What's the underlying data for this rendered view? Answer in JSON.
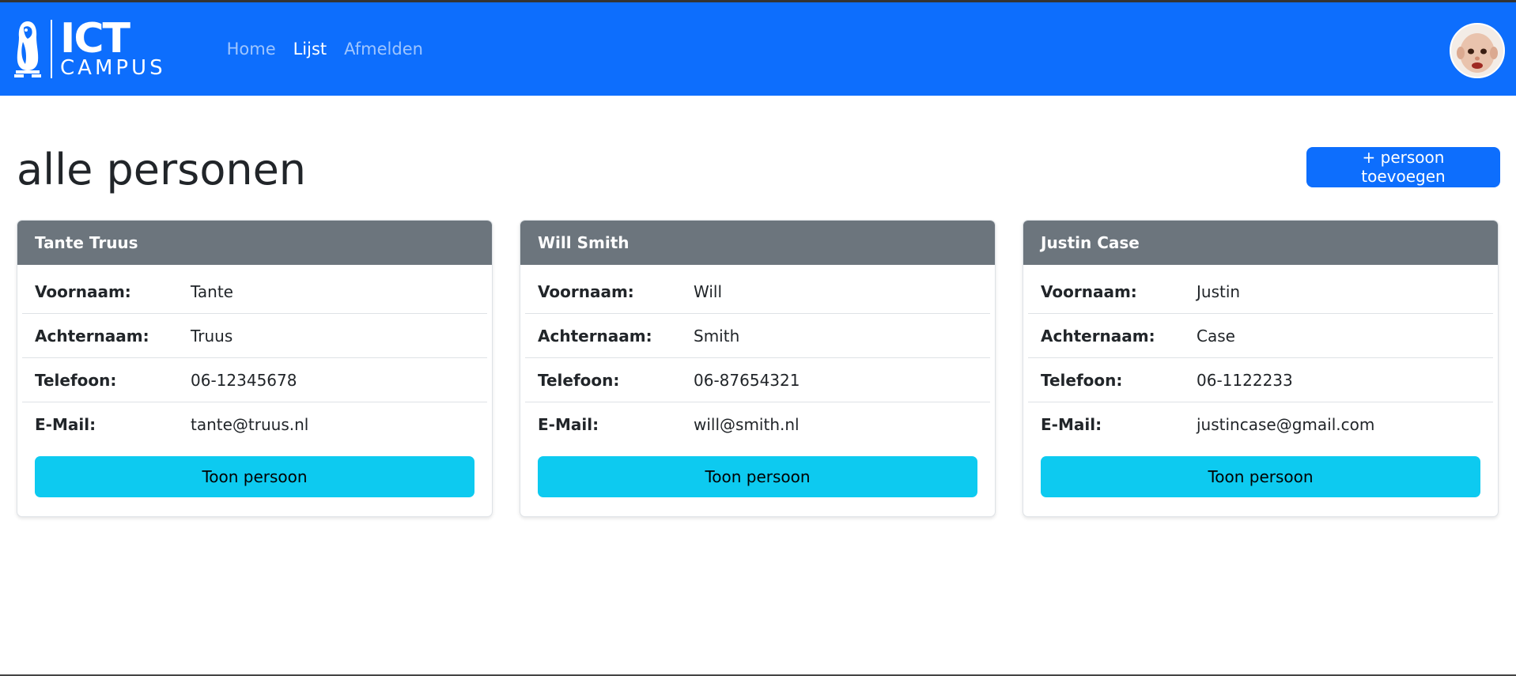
{
  "navbar": {
    "logo_main": "ICT",
    "logo_sub": "CAMPUS",
    "links": [
      {
        "label": "Home",
        "active": false
      },
      {
        "label": "Lijst",
        "active": true
      },
      {
        "label": "Afmelden",
        "active": false
      }
    ],
    "bg_color": "#0d6efd"
  },
  "page": {
    "title": "alle personen",
    "add_button": "+ persoon toevoegen"
  },
  "labels": {
    "voornaam": "Voornaam:",
    "achternaam": "Achternaam:",
    "telefoon": "Telefoon:",
    "email": "E-Mail:"
  },
  "persons": [
    {
      "name": "Tante Truus",
      "voornaam": "Tante",
      "achternaam": "Truus",
      "telefoon": "06-12345678",
      "email": "tante@truus.nl",
      "button": "Toon persoon"
    },
    {
      "name": "Will Smith",
      "voornaam": "Will",
      "achternaam": "Smith",
      "telefoon": "06-87654321",
      "email": "will@smith.nl",
      "button": "Toon persoon"
    },
    {
      "name": "Justin Case",
      "voornaam": "Justin",
      "achternaam": "Case",
      "telefoon": "06-1122233",
      "email": "justincase@gmail.com",
      "button": "Toon persoon"
    }
  ],
  "colors": {
    "card_header": "#6c757d",
    "info_button": "#0dcaf0",
    "primary": "#0d6efd"
  }
}
